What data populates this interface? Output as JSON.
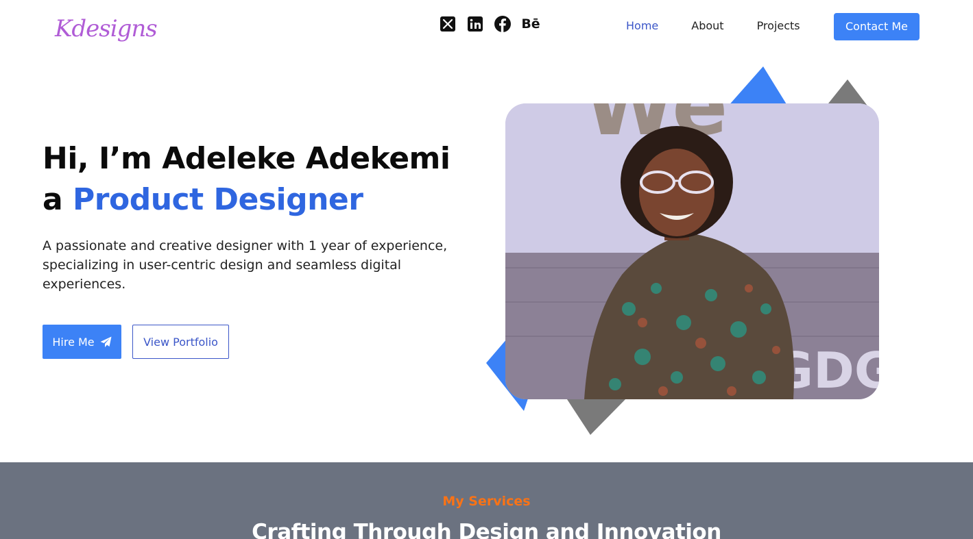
{
  "brand": {
    "logo_text": "Kdesigns",
    "logo_color": "#b05cd6"
  },
  "socials": [
    {
      "icon": "x-twitter-icon"
    },
    {
      "icon": "linkedin-icon"
    },
    {
      "icon": "facebook-icon"
    },
    {
      "icon": "behance-icon",
      "label": "Bē"
    }
  ],
  "nav": {
    "links": [
      {
        "label": "Home",
        "active": true
      },
      {
        "label": "About",
        "active": false
      },
      {
        "label": "Projects",
        "active": false
      }
    ],
    "contact_label": "Contact Me"
  },
  "hero": {
    "line1": "Hi, I’m Adeleke Adekemi",
    "line2_prefix": "a",
    "line2_accent": "Product Designer",
    "description": "A passionate and creative designer with 1 year of experience, specializing in user-centric design and seamless digital experiences.",
    "hire_label": "Hire Me",
    "hire_icon": "paper-plane-icon",
    "portfolio_label": "View Portfolio",
    "photo_wall_text_top": "We",
    "photo_wall_text_bottom": "GDG"
  },
  "services": {
    "kicker": "My Services",
    "title": "Crafting Through Design and Innovation"
  },
  "colors": {
    "accent_blue": "#3c82f6",
    "heading_blue": "#2f66e0",
    "link_active": "#3b56c8",
    "services_bg": "#6b7280",
    "services_kicker": "#f97316",
    "shape_gray": "#7a7a7a"
  }
}
